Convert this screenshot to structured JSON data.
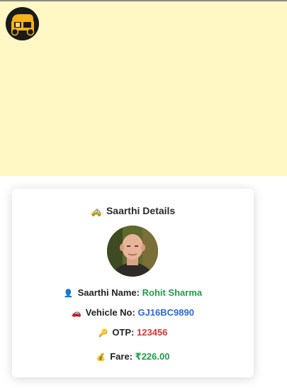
{
  "header": {
    "logo_icon": "auto-rickshaw-logo-icon",
    "background_color": "#fff8c4"
  },
  "card": {
    "title_icon": "taxi-icon",
    "title": "Saarthi Details",
    "avatar_icon": "driver-photo",
    "name": {
      "icon": "person-icon",
      "label": "Saarthi Name:",
      "value": "Rohit Sharma",
      "color": "#1e9e4a"
    },
    "vehicle": {
      "icon": "car-icon",
      "label": "Vehicle No:",
      "value": "GJ16BC9890",
      "color": "#2a6ad8"
    },
    "otp": {
      "icon": "key-icon",
      "label": "OTP:",
      "value": "123456",
      "color": "#d63535"
    },
    "fare": {
      "icon": "money-bag-icon",
      "label": "Fare:",
      "value": "₹226.00",
      "color": "#1e9e4a"
    }
  }
}
